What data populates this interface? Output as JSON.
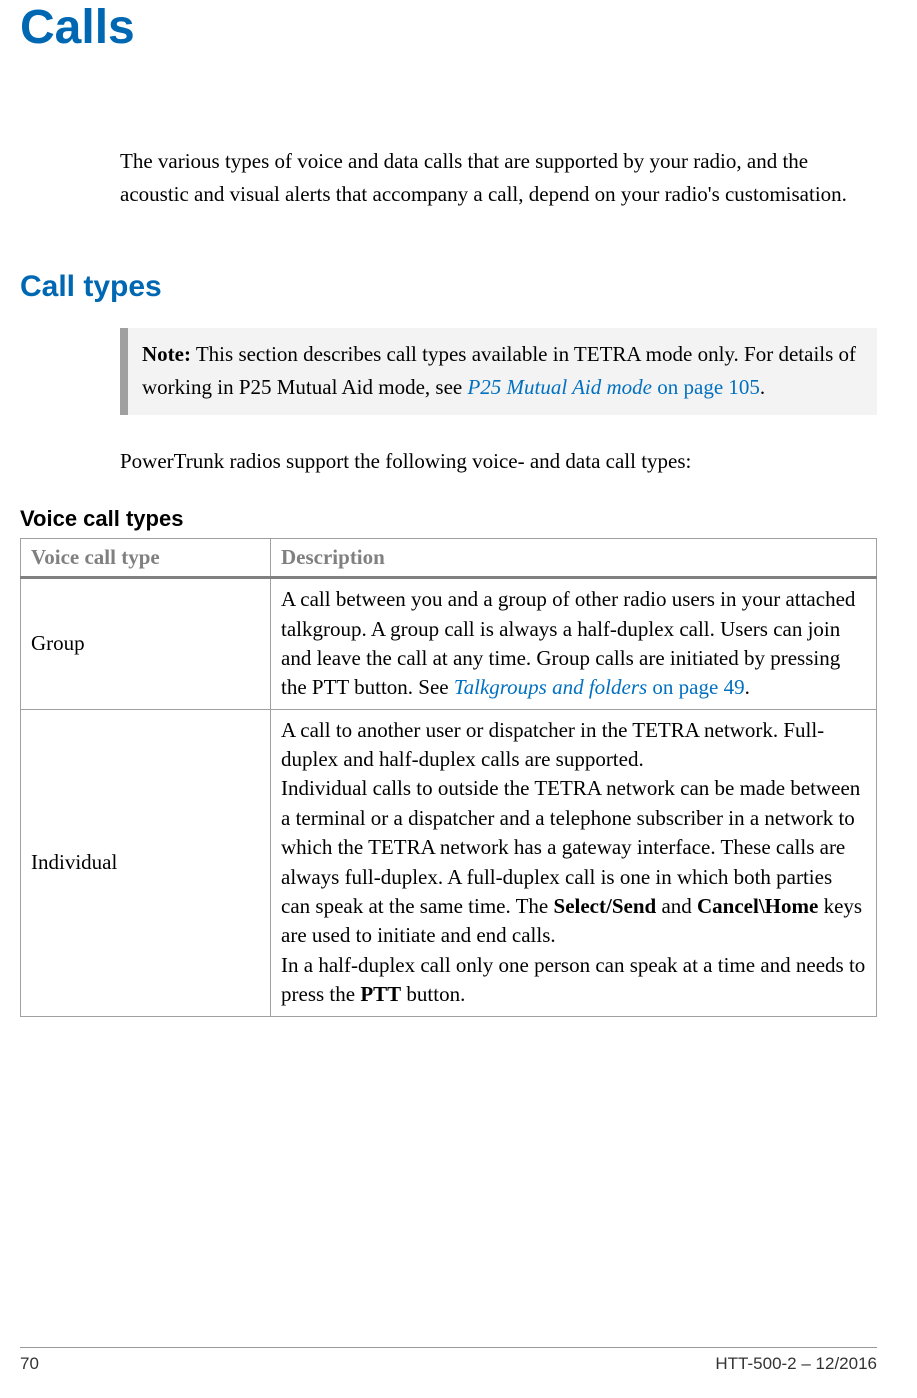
{
  "title": "Calls",
  "intro": "The various types of voice and data calls that are supported by your radio, and the acoustic and visual alerts that accompany a call, depend on your radio's customisation.",
  "section_call_types": "Call types",
  "note": {
    "label": "Note:",
    "text_before": "  This section describes call types available in TETRA mode only. For details of working in P25 Mutual Aid mode, see ",
    "link_text": "P25 Mutual Aid mode",
    "link_page": " on page 105",
    "period": "."
  },
  "support_line": "PowerTrunk radios support the following voice- and data call types:",
  "voice_heading": "Voice call types",
  "table": {
    "headers": {
      "col1": "Voice call type",
      "col2": "Description"
    },
    "rows": [
      {
        "type": "Group",
        "desc_pre": "A call between you and a group of other radio users in your attached talkgroup. A group call is always a half-duplex call. Users can join and leave the call at any time. Group calls are initiated by pressing the PTT button. See ",
        "desc_link": "Talkgroups and folders",
        "desc_linkpage": " on page 49",
        "desc_post": "."
      },
      {
        "type": "Individual",
        "para1": "A call to another user or dispatcher in the TETRA network. Full-duplex and half-duplex calls are supported.",
        "para2_pre": "Individual calls to outside the TETRA network can be made between a terminal or a dispatcher and a telephone subscriber in a network to which the TETRA network has a gateway interface. These calls are always full-duplex. A full-duplex call is one in which both parties can speak at the same time. The ",
        "key1": "Select/Send",
        "para2_mid": " and ",
        "key2": "Cancel\\Home",
        "para2_post": " keys are used to initiate and end calls.",
        "para3_pre": "In a half-duplex call only one person can speak at a time and needs to press the ",
        "key3": "PTT",
        "para3_post": " button."
      }
    ]
  },
  "footer": {
    "page": "70",
    "docid": "HTT-500-2 – 12/2016"
  }
}
